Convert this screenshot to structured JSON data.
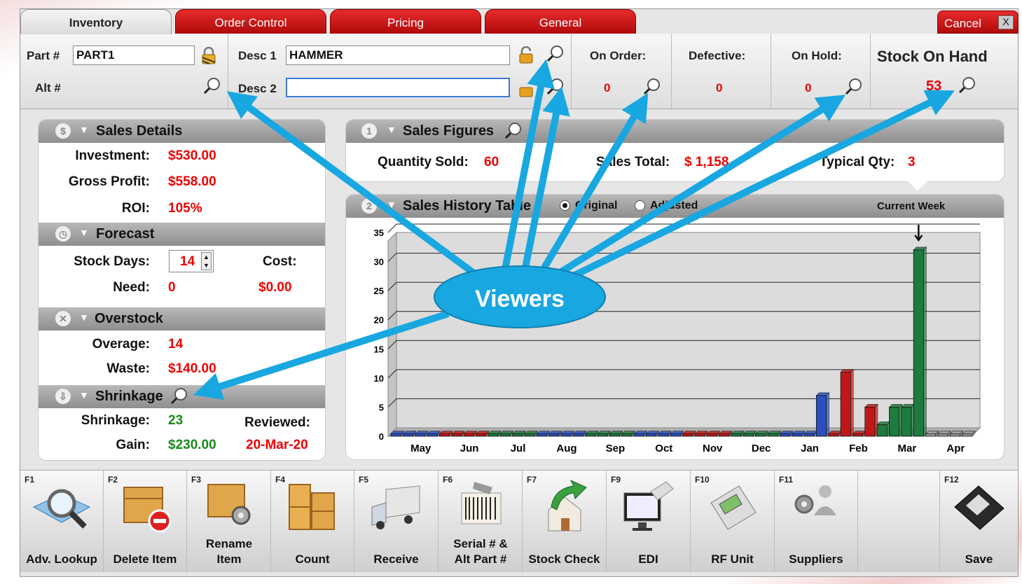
{
  "tabs": [
    "Inventory",
    "Order Control",
    "Pricing",
    "General"
  ],
  "cancel_label": "Cancel",
  "cancel_x": "X",
  "header": {
    "part_label": "Part #",
    "part_value": "PART1",
    "alt_label": "Alt #",
    "desc1_label": "Desc 1",
    "desc1_value": "HAMMER",
    "desc2_label": "Desc 2",
    "desc2_value": "",
    "on_order_label": "On Order:",
    "on_order_value": "0",
    "defective_label": "Defective:",
    "defective_value": "0",
    "on_hold_label": "On Hold:",
    "on_hold_value": "0",
    "stock_label": "Stock On Hand",
    "stock_value": "53"
  },
  "sales_details": {
    "icon_text": "$",
    "title": "Sales Details",
    "investment_label": "Investment:",
    "investment_value": "$530.00",
    "gross_profit_label": "Gross Profit:",
    "gross_profit_value": "$558.00",
    "roi_label": "ROI:",
    "roi_value": "105%"
  },
  "forecast": {
    "title": "Forecast",
    "stock_days_label": "Stock Days:",
    "stock_days_value": "14",
    "cost_label": "Cost:",
    "cost_value": "$0.00",
    "need_label": "Need:",
    "need_value": "0"
  },
  "overstock": {
    "title": "Overstock",
    "overage_label": "Overage:",
    "overage_value": "14",
    "waste_label": "Waste:",
    "waste_value": "$140.00"
  },
  "shrinkage": {
    "title": "Shrinkage",
    "shrinkage_label": "Shrinkage:",
    "shrinkage_value": "23",
    "reviewed_label": "Reviewed:",
    "reviewed_value": "20-Mar-20",
    "gain_label": "Gain:",
    "gain_value": "$230.00"
  },
  "sales_figures": {
    "number": "1",
    "title": "Sales Figures",
    "qty_sold_label": "Quantity Sold:",
    "qty_sold_value": "60",
    "sales_total_label": "Sales Total:",
    "sales_total_value": "$ 1,158",
    "typical_label": "Typical Qty:",
    "typical_value": "3"
  },
  "sales_history": {
    "number": "2",
    "title": "Sales History Table",
    "original_label": "Original",
    "adjusted_label": "Adjusted",
    "current_week_label": "Current Week"
  },
  "chart_data": {
    "type": "bar",
    "categories": [
      "May",
      "Jun",
      "Jul",
      "Aug",
      "Sep",
      "Oct",
      "Nov",
      "Dec",
      "Jan",
      "Feb",
      "Mar",
      "Apr"
    ],
    "yticks": [
      0,
      5,
      10,
      15,
      20,
      25,
      30,
      35
    ],
    "ylim": [
      0,
      35
    ],
    "weeks_per_month": [
      4,
      4,
      4,
      4,
      4,
      4,
      4,
      4,
      4,
      4,
      4,
      4
    ],
    "weekly_values": [
      0,
      0,
      0,
      0,
      0,
      0,
      0,
      0,
      0,
      0,
      0,
      0,
      0,
      0,
      0,
      0,
      0,
      0,
      0,
      0,
      0,
      0,
      0,
      0,
      0,
      0,
      0,
      0,
      0,
      0,
      0,
      0,
      0,
      0,
      0,
      7,
      0,
      11,
      0,
      5,
      2,
      5,
      5,
      32,
      0,
      0,
      0,
      0
    ],
    "month_colors": [
      "#2b4fbf",
      "#c01818",
      "#1e7a3e",
      "#2b4fbf",
      "#1e7a3e",
      "#2b4fbf",
      "#c01818",
      "#1e7a3e",
      "#2b4fbf",
      "#c01818",
      "#1e7a3e",
      "#999999"
    ],
    "current_week_index": 43,
    "grid": true
  },
  "fkeys": [
    {
      "key": "F1",
      "label": "Adv. Lookup",
      "icon": "magnifier-book-icon"
    },
    {
      "key": "F2",
      "label": "Delete Item",
      "icon": "box-delete-icon"
    },
    {
      "key": "F3",
      "label": "Rename Item",
      "icon": "box-gears-icon"
    },
    {
      "key": "F4",
      "label": "Count",
      "icon": "boxes-icon"
    },
    {
      "key": "F5",
      "label": "Receive",
      "icon": "truck-icon"
    },
    {
      "key": "F6",
      "label": "Serial # & Alt Part #",
      "icon": "barcode-scanner-icon"
    },
    {
      "key": "F7",
      "label": "Stock Check",
      "icon": "house-arrow-icon"
    },
    {
      "key": "F9",
      "label": "EDI",
      "icon": "monitor-cable-icon"
    },
    {
      "key": "F10",
      "label": "RF Unit",
      "icon": "handheld-device-icon"
    },
    {
      "key": "F11",
      "label": "Suppliers",
      "icon": "people-gears-icon"
    },
    {
      "key": "F12",
      "label": "Save",
      "icon": "floppy-disk-icon"
    }
  ],
  "callout_text": "Viewers",
  "colors": {
    "accent_red": "#e00000",
    "callout_blue": "#18a7e0",
    "value_green": "#1a8a1a"
  }
}
